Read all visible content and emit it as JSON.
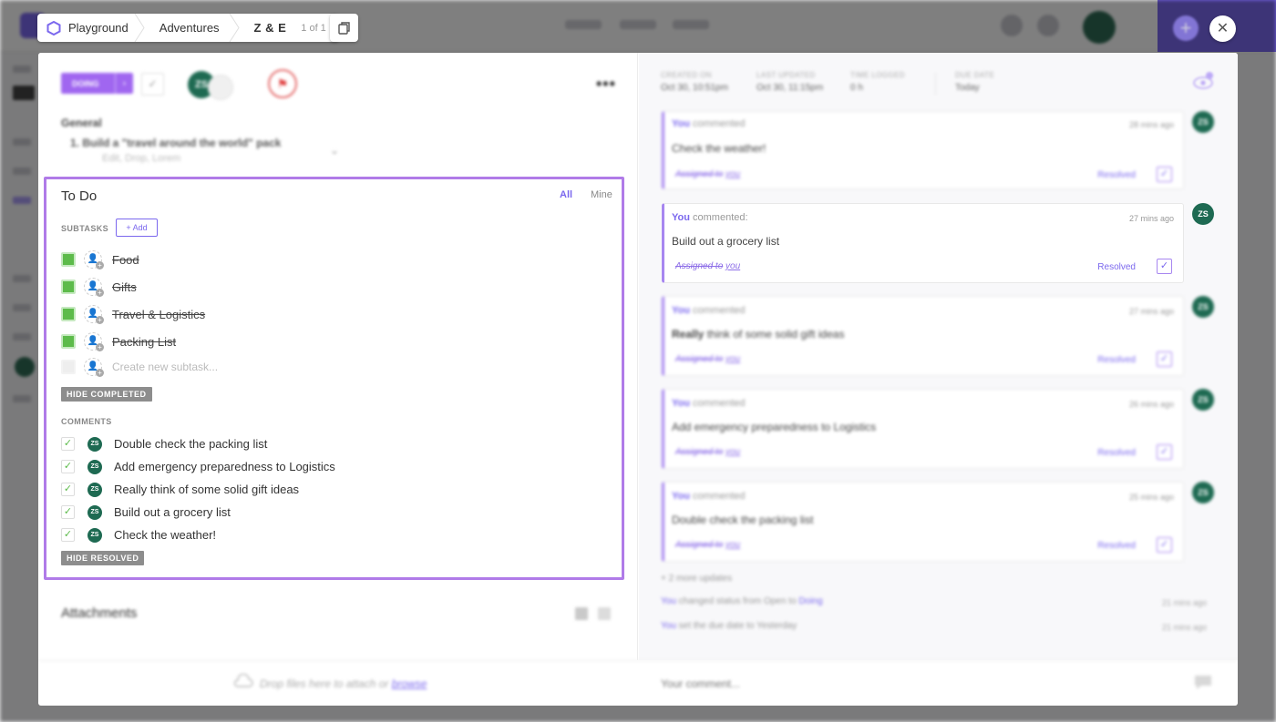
{
  "breadcrumb": {
    "space": "Playground",
    "list": "Adventures",
    "task": "Z & E",
    "count": "1 of 1"
  },
  "task": {
    "status": "DOING",
    "assignee_initials": "ZS"
  },
  "general": {
    "title": "General",
    "item": "1.  Build a \"travel around the world\" pack",
    "subitem": "Edit, Drop, Lorem"
  },
  "todo": {
    "title": "To Do",
    "filter_all": "All",
    "filter_mine": "Mine",
    "subtasks_label": "SUBTASKS",
    "add_label": "+ Add",
    "subtasks": [
      {
        "label": "Food"
      },
      {
        "label": "Gifts"
      },
      {
        "label": "Travel & Logistics"
      },
      {
        "label": "Packing List"
      }
    ],
    "new_subtask_placeholder": "Create new subtask...",
    "hide_completed": "HIDE COMPLETED",
    "comments_label": "COMMENTS",
    "comments": [
      {
        "initials": "ZS",
        "text": "Double check the packing list"
      },
      {
        "initials": "ZS",
        "text": "Add emergency preparedness to Logistics"
      },
      {
        "initials": "ZS",
        "text": "Really think of some solid gift ideas"
      },
      {
        "initials": "ZS",
        "text": "Build out a grocery list"
      },
      {
        "initials": "ZS",
        "text": "Check the weather!"
      }
    ],
    "hide_resolved": "HIDE RESOLVED"
  },
  "attachments": {
    "title": "Attachments"
  },
  "meta": {
    "created_label": "CREATED ON",
    "created_value": "Oct 30, 10:51pm",
    "updated_label": "LAST UPDATED",
    "updated_value": "Oct 30, 11:15pm",
    "time_label": "TIME LOGGED",
    "time_value": "0 h",
    "due_label": "DUE DATE",
    "due_value": "Today"
  },
  "activity": {
    "comments": [
      {
        "author": "You",
        "verb": "commented",
        "time": "28 mins ago",
        "body": "Check the weather!",
        "assigned": "Assigned to",
        "assigned_you": "you",
        "resolved": "Resolved",
        "initials": "ZS"
      },
      {
        "author": "You",
        "verb": "commented:",
        "time": "27 mins ago",
        "body": "Build out a grocery list",
        "assigned": "Assigned to",
        "assigned_you": "you",
        "resolved": "Resolved",
        "initials": "ZS"
      },
      {
        "author": "You",
        "verb": "commented",
        "time": "27 mins ago",
        "body_bold": "Really",
        "body": "think of some solid gift ideas",
        "assigned": "Assigned to",
        "assigned_you": "you",
        "resolved": "Resolved",
        "initials": "ZS"
      },
      {
        "author": "You",
        "verb": "commented",
        "time": "26 mins ago",
        "body": "Add emergency preparedness to Logistics",
        "assigned": "Assigned to",
        "assigned_you": "you",
        "resolved": "Resolved",
        "initials": "ZS"
      },
      {
        "author": "You",
        "verb": "commented",
        "time": "25 mins ago",
        "body": "Double check the packing list",
        "assigned": "Assigned to",
        "assigned_you": "you",
        "resolved": "Resolved",
        "initials": "ZS"
      }
    ],
    "more_updates": "+ 2 more updates",
    "status_change": {
      "author": "You",
      "text": "changed status from",
      "from": "Open",
      "to_word": "to",
      "to": "Doing",
      "time": "21 mins ago"
    },
    "due_change": {
      "author": "You",
      "text": "set the due date to",
      "value": "Yesterday",
      "time": "21 mins ago"
    }
  },
  "footer": {
    "drop_text": "Drop files here to attach or",
    "browse": "browse",
    "comment_placeholder": "Your comment..."
  },
  "colors": {
    "accent": "#7b68ee",
    "highlight_border": "#b07be8",
    "done_green": "#5dbb4b",
    "avatar_green": "#1e6a52"
  }
}
